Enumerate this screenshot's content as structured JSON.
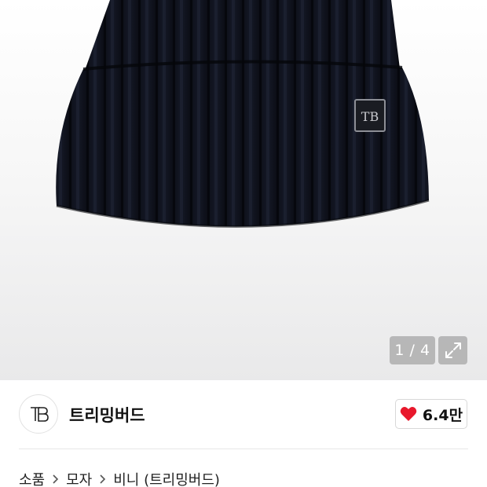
{
  "gallery": {
    "counter": "1 / 4",
    "expand_icon": "expand-arrows-icon",
    "product_image": "black-knit-beanie"
  },
  "brand": {
    "logo_monogram": "TB",
    "name": "트리밍버드"
  },
  "like": {
    "icon": "heart-icon",
    "icon_color": "#e8182c",
    "count": "6.4만"
  },
  "breadcrumb": {
    "items": [
      "소품",
      "모자",
      "비니 (트리밍버드)"
    ],
    "separator_icon": "chevron-right-icon"
  }
}
